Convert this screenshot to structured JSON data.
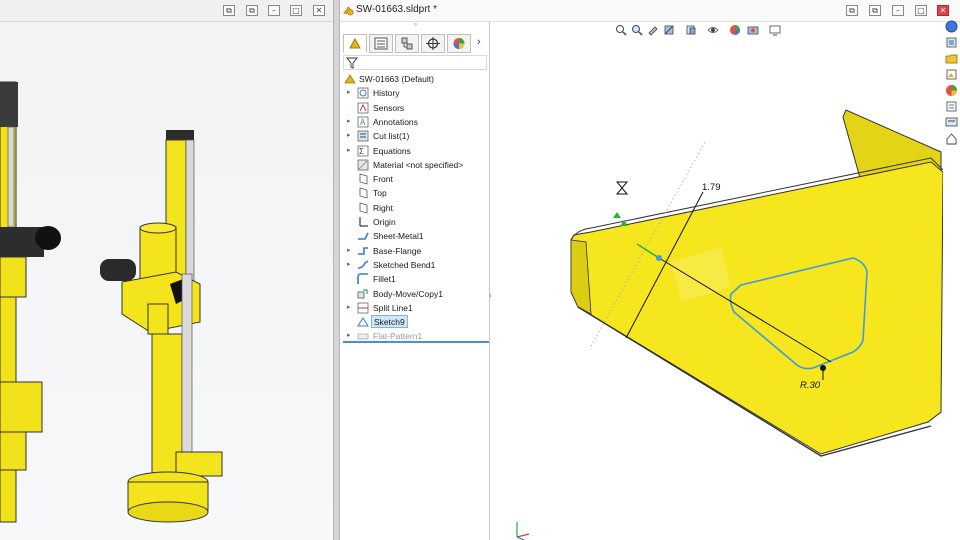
{
  "left_window": {
    "title_buttons": [
      "⧉",
      "⧉",
      "–",
      "□",
      "✕"
    ]
  },
  "document": {
    "title": "SW-01663.sldprt *",
    "window_buttons": [
      "⧉",
      "⧉",
      "–",
      "□",
      "✕"
    ]
  },
  "feature_manager": {
    "grip": "»",
    "tabs": [
      "feature-manager",
      "property-manager",
      "configuration-manager",
      "dimxpert-manager",
      "display-manager"
    ],
    "expand": "›",
    "tree": [
      {
        "label": "SW-01663 (Default)",
        "icon": "part-icon",
        "expandable": false,
        "root": true
      },
      {
        "label": "History",
        "icon": "history-icon",
        "expandable": true
      },
      {
        "label": "Sensors",
        "icon": "sensors-icon",
        "expandable": false
      },
      {
        "label": "Annotations",
        "icon": "annotations-icon",
        "expandable": true
      },
      {
        "label": "Cut list(1)",
        "icon": "cut-list-icon",
        "expandable": true
      },
      {
        "label": "Equations",
        "icon": "equations-icon",
        "expandable": true
      },
      {
        "label": "Material <not specified>",
        "icon": "material-icon",
        "expandable": false
      },
      {
        "label": "Front",
        "icon": "plane-icon",
        "expandable": false
      },
      {
        "label": "Top",
        "icon": "plane-icon",
        "expandable": false
      },
      {
        "label": "Right",
        "icon": "plane-icon",
        "expandable": false
      },
      {
        "label": "Origin",
        "icon": "origin-icon",
        "expandable": false
      },
      {
        "label": "Sheet-Metal1",
        "icon": "sheet-metal-icon",
        "expandable": false
      },
      {
        "label": "Base-Flange",
        "icon": "base-flange-icon",
        "expandable": true
      },
      {
        "label": "Sketched Bend1",
        "icon": "sketched-bend-icon",
        "expandable": true
      },
      {
        "label": "Fillet1",
        "icon": "fillet-icon",
        "expandable": false
      },
      {
        "label": "Body-Move/Copy1",
        "icon": "move-copy-icon",
        "expandable": false
      },
      {
        "label": "Split Line1",
        "icon": "split-line-icon",
        "expandable": true
      },
      {
        "label": "Sketch9",
        "icon": "sketch-icon",
        "expandable": false,
        "selected": true
      },
      {
        "label": "Flat-Pattern1",
        "icon": "flat-pattern-icon",
        "expandable": true,
        "suppressed": true
      }
    ]
  },
  "graphics": {
    "dimension_linear": "1.79",
    "dimension_radius": "R.30",
    "part_color": "#f5e61e",
    "sketch_color": "#3d9be0"
  },
  "colors": {
    "accent": "#4a8fd6",
    "selection": "#cfe6fb"
  }
}
